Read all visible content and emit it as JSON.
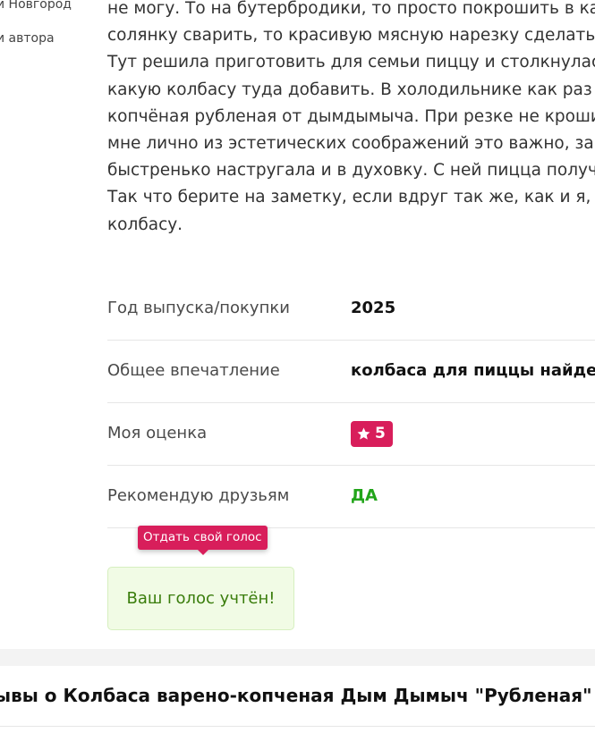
{
  "author": {
    "city": "й Новгород",
    "link_label": "и автора"
  },
  "review": {
    "lines": [
      "не могу. То на бутербродики, то просто покрошить в ка",
      "солянку сварить, то красивую мясную нарезку сделать",
      "Тут решила приготовить для семьи пиццу и столкнулас",
      "какую колбасу туда добавить. В холодильнике как раз (",
      "копчёная рубленая от дымдымыча. При резке не кроши",
      "мне лично из эстетических соображений это важно, за",
      "быстренько настругала и в духовку. С ней пицца получ",
      "Так что берите на заметку, если вдруг так же, как и я, н",
      "колбасу."
    ]
  },
  "attributes": {
    "year": {
      "label": "Год выпуска/покупки",
      "value": "2025"
    },
    "impression": {
      "label": "Общее впечатление",
      "value": "колбаса для пиццы найдена"
    },
    "rating": {
      "label": "Моя оценка",
      "value": "5",
      "icon": "star-icon",
      "color": "#d81e5b"
    },
    "recommend": {
      "label": "Рекомендую друзьям",
      "value": "ДА",
      "color": "#22a51a"
    }
  },
  "vote": {
    "tooltip": "Отдать свой голос",
    "confirmation": "Ваш голос учтён!"
  },
  "reviews_section": {
    "heading": "ывы о Колбаса варено-копченая Дым Дымыч \"Рубленая\""
  }
}
